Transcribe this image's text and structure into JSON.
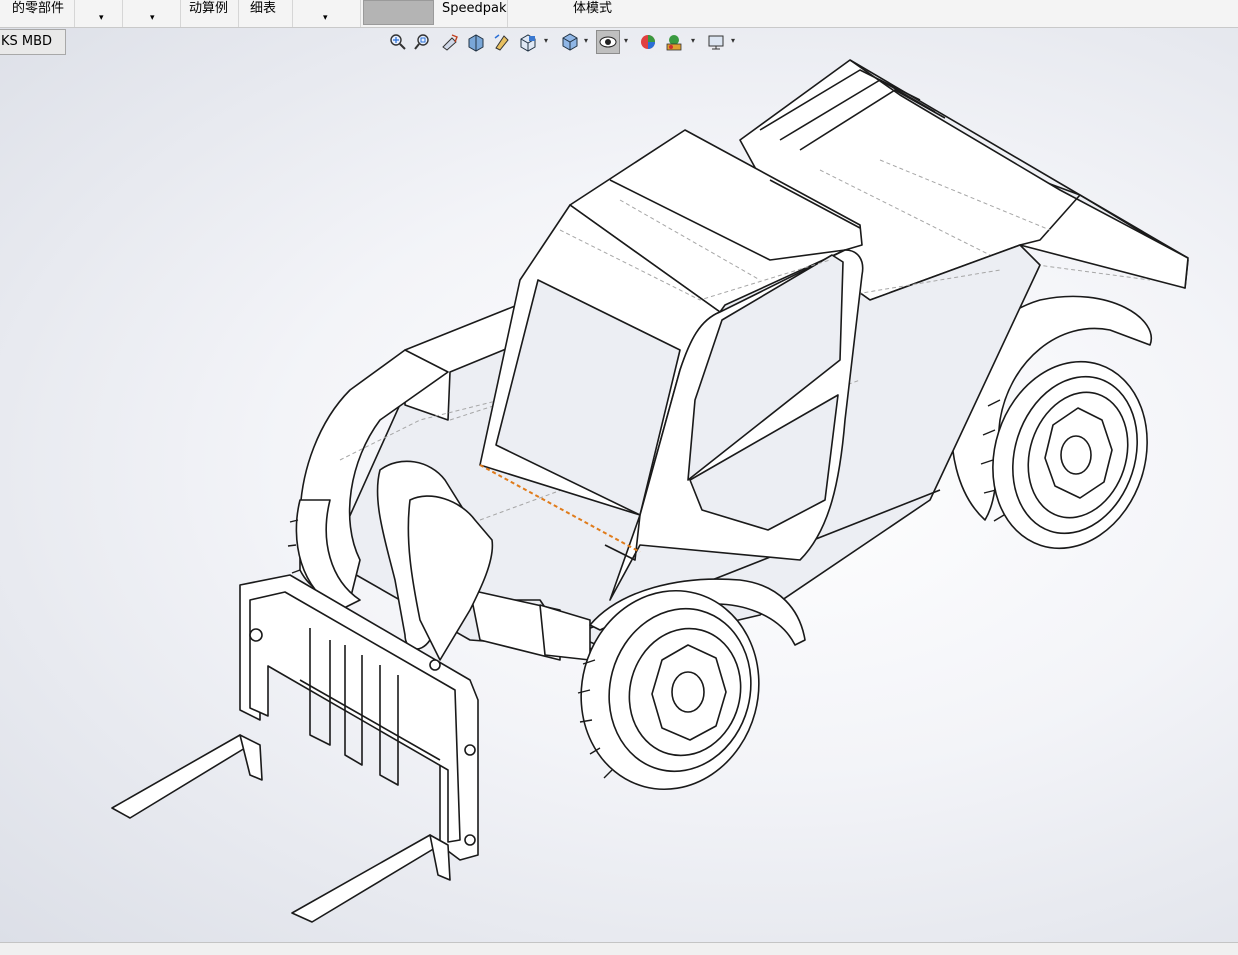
{
  "ribbon": {
    "part_of_assembly": "的零部件",
    "motion_study": "动算例",
    "bom": "细表",
    "speedpak": "Speedpak",
    "body_mode": "体模式"
  },
  "tabs": {
    "mbd": "KS MBD"
  },
  "view_toolbar": {
    "icons": [
      "zoom-to-fit-icon",
      "zoom-to-area-icon",
      "previous-view-icon",
      "section-view-icon",
      "dynamic-annotation-views-icon",
      "view-orientation-icon",
      "display-style-icon",
      "hide-show-items-icon",
      "edit-appearance-icon",
      "apply-scene-icon",
      "view-settings-icon"
    ],
    "active": "hide-show-items-icon"
  },
  "colors": {
    "edge": "#1a1a1a",
    "hidden_edge": "#9a9a9a",
    "selected_edge": "#e07b1a",
    "toolbar_bg": "#f4f4f4"
  }
}
